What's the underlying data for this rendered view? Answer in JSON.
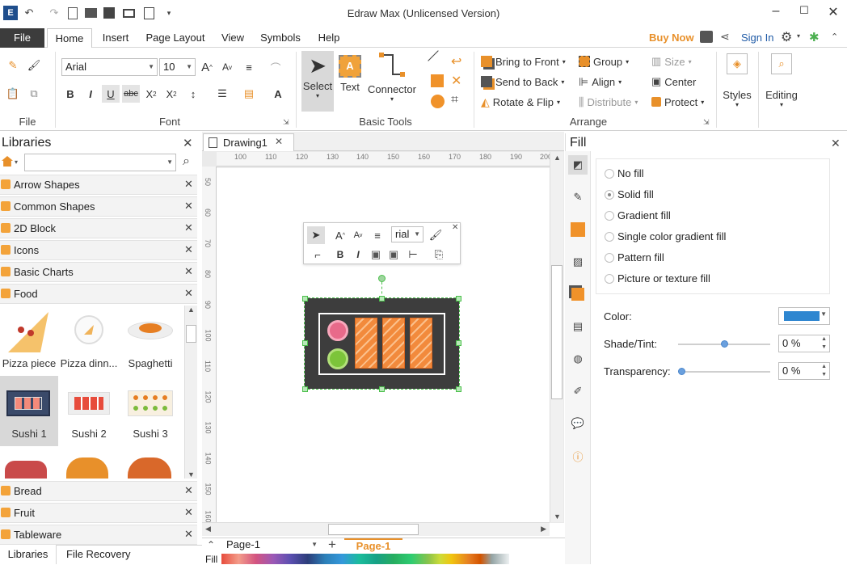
{
  "app": {
    "title": "Edraw Max (Unlicensed Version)",
    "buy_now": "Buy Now",
    "sign_in": "Sign In"
  },
  "menu": {
    "file": "File",
    "tabs": [
      "Home",
      "Insert",
      "Page Layout",
      "View",
      "Symbols",
      "Help"
    ],
    "active_tab": "Home"
  },
  "ribbon": {
    "groups": {
      "file": "File",
      "font": "Font",
      "basic_tools": "Basic Tools",
      "arrange": "Arrange"
    },
    "font_name": "Arial",
    "font_size": "10",
    "tools": {
      "select": "Select",
      "text": "Text",
      "connector": "Connector",
      "text_icon_letter": "A"
    },
    "arrange": {
      "bring_to_front": "Bring to Front",
      "send_to_back": "Send to Back",
      "rotate_flip": "Rotate & Flip",
      "group": "Group",
      "align": "Align",
      "distribute": "Distribute",
      "size": "Size",
      "center": "Center",
      "protect": "Protect"
    },
    "styles": "Styles",
    "editing": "Editing"
  },
  "libraries": {
    "title": "Libraries",
    "search_placeholder": "",
    "categories_top": [
      "Arrow Shapes",
      "Common Shapes",
      "2D Block",
      "Icons",
      "Basic Charts",
      "Food"
    ],
    "shapes": [
      "Pizza piece",
      "Pizza dinn...",
      "Spaghetti",
      "Sushi 1",
      "Sushi 2",
      "Sushi 3"
    ],
    "categories_bottom": [
      "Bread",
      "Fruit",
      "Tableware"
    ],
    "bottom_tabs": [
      "Libraries",
      "File Recovery"
    ]
  },
  "document": {
    "tab": "Drawing1",
    "ruler_h": [
      "100",
      "110",
      "120",
      "130",
      "140",
      "150",
      "160",
      "170",
      "180",
      "190",
      "200"
    ],
    "ruler_v": [
      "50",
      "60",
      "70",
      "80",
      "90",
      "100",
      "110",
      "120",
      "130",
      "140",
      "150",
      "160"
    ],
    "mini_font": "rial",
    "page_select": "Page-1",
    "page_tab": "Page-1",
    "fill_label": "Fill"
  },
  "fill_pane": {
    "title": "Fill",
    "options": [
      "No fill",
      "Solid fill",
      "Gradient fill",
      "Single color gradient fill",
      "Pattern fill",
      "Picture or texture fill"
    ],
    "selected_option": "Solid fill",
    "color_label": "Color:",
    "color_value": "#2e86d0",
    "shade_label": "Shade/Tint:",
    "shade_value": "0 %",
    "transparency_label": "Transparency:",
    "transparency_value": "0 %"
  },
  "colors": {
    "accent_orange": "#e8902a",
    "file_tab": "#3c3c3c",
    "sushi_board": "#3d3d3d",
    "selection": "#4bbf4b"
  }
}
